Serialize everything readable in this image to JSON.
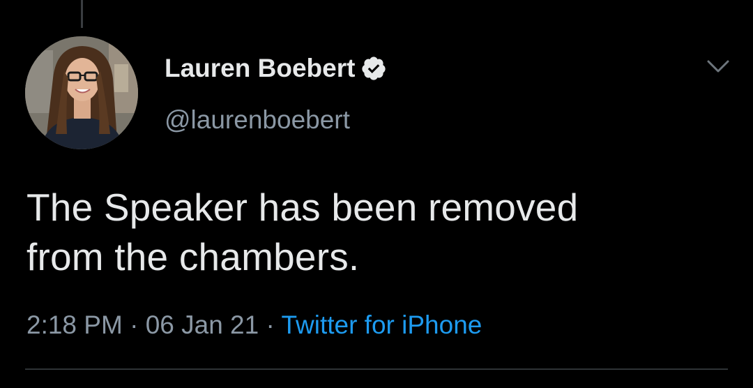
{
  "tweet": {
    "author": {
      "display_name": "Lauren Boebert",
      "handle": "@laurenboebert",
      "verified_icon": "verified-badge-icon",
      "avatar_icon": "profile-photo"
    },
    "text_line_1": "The Speaker has been removed",
    "text_line_2": "from the chambers.",
    "meta": {
      "time": "2:18 PM",
      "sep1": " · ",
      "date": "06 Jan 21",
      "sep2": " · ",
      "source": "Twitter for iPhone"
    },
    "more_icon": "chevron-down-icon"
  },
  "colors": {
    "background": "#000000",
    "primary_text": "#e7e9ea",
    "secondary_text": "#8b98a5",
    "link": "#1d9bf0"
  }
}
